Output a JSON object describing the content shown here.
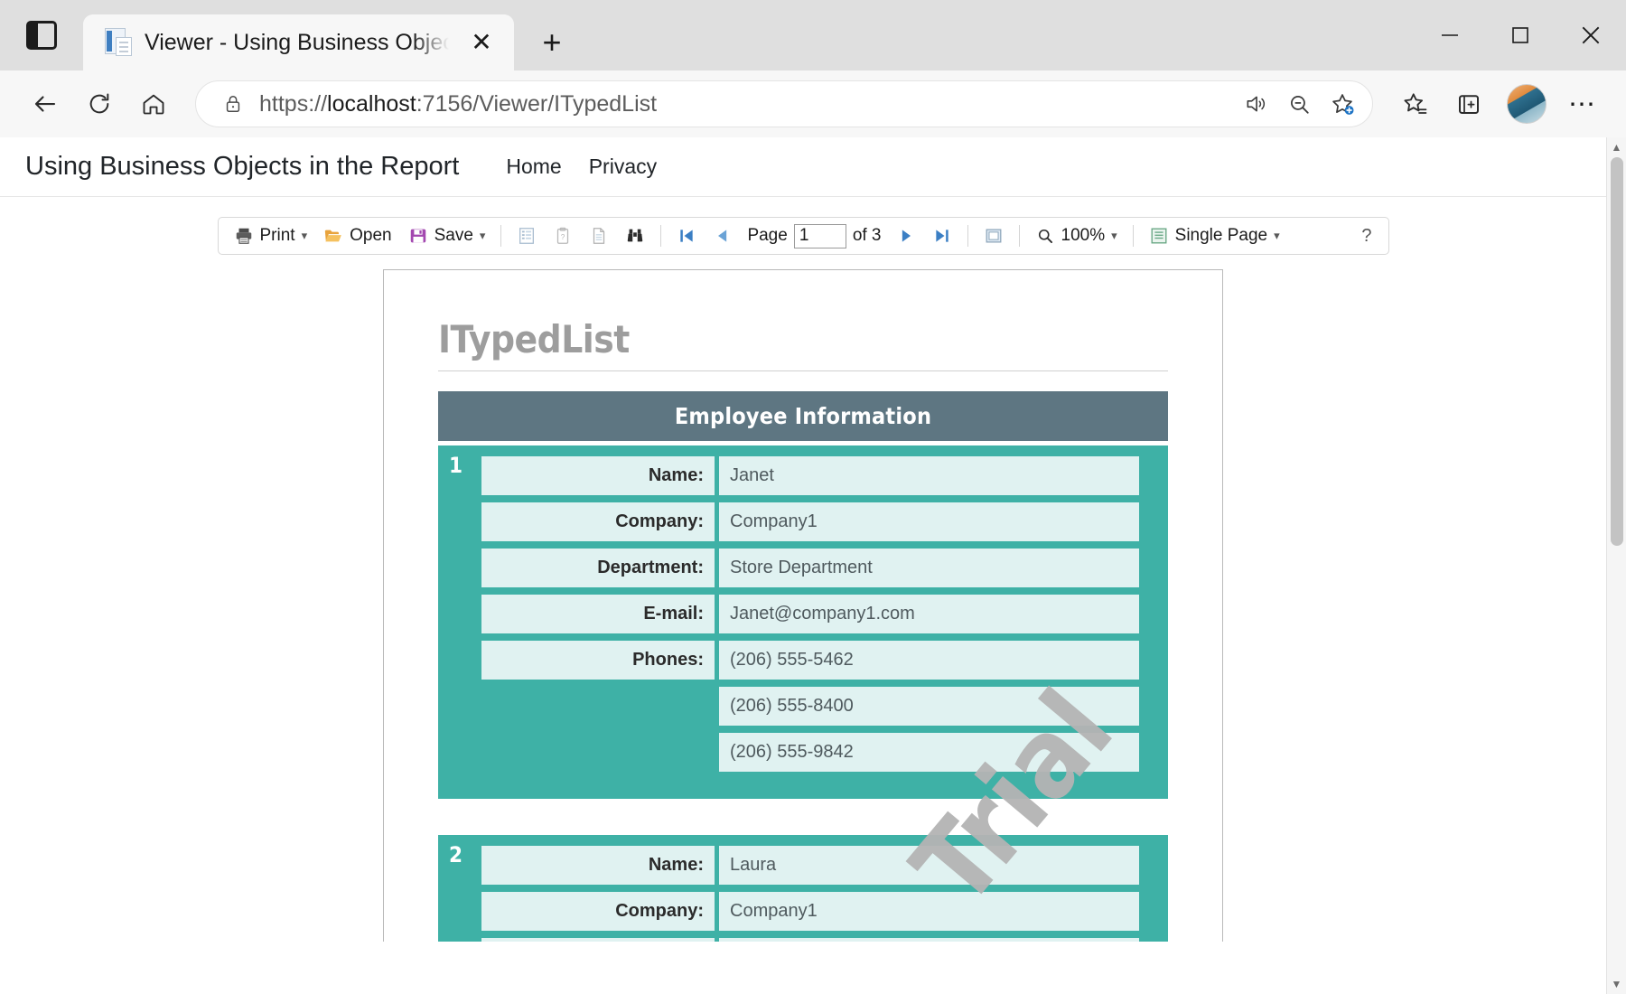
{
  "browser": {
    "tab_strip_toggle_icon": "split-screen-icon",
    "tab": {
      "favicon": "document-icon",
      "title": "Viewer - Using Business Objects i",
      "close_icon": "close-icon"
    },
    "new_tab_label": "+",
    "window_controls": {
      "minimize": "minimize-icon",
      "maximize": "maximize-icon",
      "close": "close-icon"
    },
    "nav": {
      "back_icon": "back-arrow-icon",
      "refresh_icon": "refresh-icon",
      "home_icon": "home-icon"
    },
    "address": {
      "lock_icon": "lock-icon",
      "url_scheme": "https://",
      "url_host": "localhost",
      "url_path": ":7156/Viewer/ITypedList",
      "url_full": "https://localhost:7156/Viewer/ITypedList",
      "read_aloud_icon": "read-aloud-icon",
      "zoom_out_icon": "zoom-out-icon",
      "add_favorite_icon": "add-favorite-icon"
    },
    "toolbar_right": {
      "favorites_icon": "favorites-icon",
      "collections_icon": "collections-icon",
      "profile_icon": "avatar",
      "settings_icon": "ellipsis-icon",
      "settings_label": "⋯"
    }
  },
  "site": {
    "brand": "Using Business Objects in the Report",
    "nav": [
      {
        "label": "Home"
      },
      {
        "label": "Privacy"
      }
    ]
  },
  "viewer_toolbar": {
    "print_label": "Print",
    "print_icon": "printer-icon",
    "open_label": "Open",
    "open_icon": "folder-open-icon",
    "save_label": "Save",
    "save_icon": "floppy-disk-icon",
    "outline_icon": "outline-icon",
    "parameters_icon": "parameters-icon",
    "pages_icon": "page-copy-icon",
    "search_icon": "binoculars-icon",
    "first_page_icon": "first-page-icon",
    "prev_page_icon": "previous-page-icon",
    "page_label": "Page",
    "page_value": "1",
    "page_of": "of 3",
    "next_page_icon": "next-page-icon",
    "last_page_icon": "last-page-icon",
    "fit_page_icon": "fit-page-icon",
    "zoom_icon": "magnifier-icon",
    "zoom_value": "100%",
    "view_mode_icon": "single-page-icon",
    "view_mode_label": "Single Page",
    "help_label": "?",
    "caret": "⌄"
  },
  "report": {
    "title": "ITypedList",
    "section_header": "Employee Information",
    "watermark": "Trial",
    "accent_color": "#3eb1a6",
    "header_color": "#5e7682",
    "field_bg_color": "#e0f2f1",
    "records": [
      {
        "number": "1",
        "fields": [
          {
            "label": "Name:",
            "value": "Janet"
          },
          {
            "label": "Company:",
            "value": "Company1"
          },
          {
            "label": "Department:",
            "value": "Store Department"
          },
          {
            "label": "E-mail:",
            "value": "Janet@company1.com"
          },
          {
            "label": "Phones:",
            "value": "(206) 555-5462"
          },
          {
            "label": "",
            "value": "(206) 555-8400"
          },
          {
            "label": "",
            "value": "(206) 555-9842"
          }
        ]
      },
      {
        "number": "2",
        "fields": [
          {
            "label": "Name:",
            "value": "Laura"
          },
          {
            "label": "Company:",
            "value": "Company1"
          }
        ]
      }
    ]
  }
}
